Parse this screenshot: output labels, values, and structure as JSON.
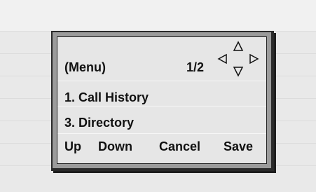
{
  "display": {
    "title": "(Menu)",
    "page": "1/2",
    "items": [
      "1. Call History",
      "3. Directory"
    ]
  },
  "softkeys": [
    "Up",
    "Down",
    "Cancel",
    "Save"
  ],
  "icons": {
    "nav_up": "triangle-up-outline",
    "nav_down": "triangle-down-outline",
    "nav_left": "triangle-left-outline",
    "nav_right": "triangle-right-outline"
  },
  "colors": {
    "background": "#e9e9e9",
    "bezel": "#9b9b9b",
    "lcd": "#e6e6e6",
    "text": "#111111"
  }
}
